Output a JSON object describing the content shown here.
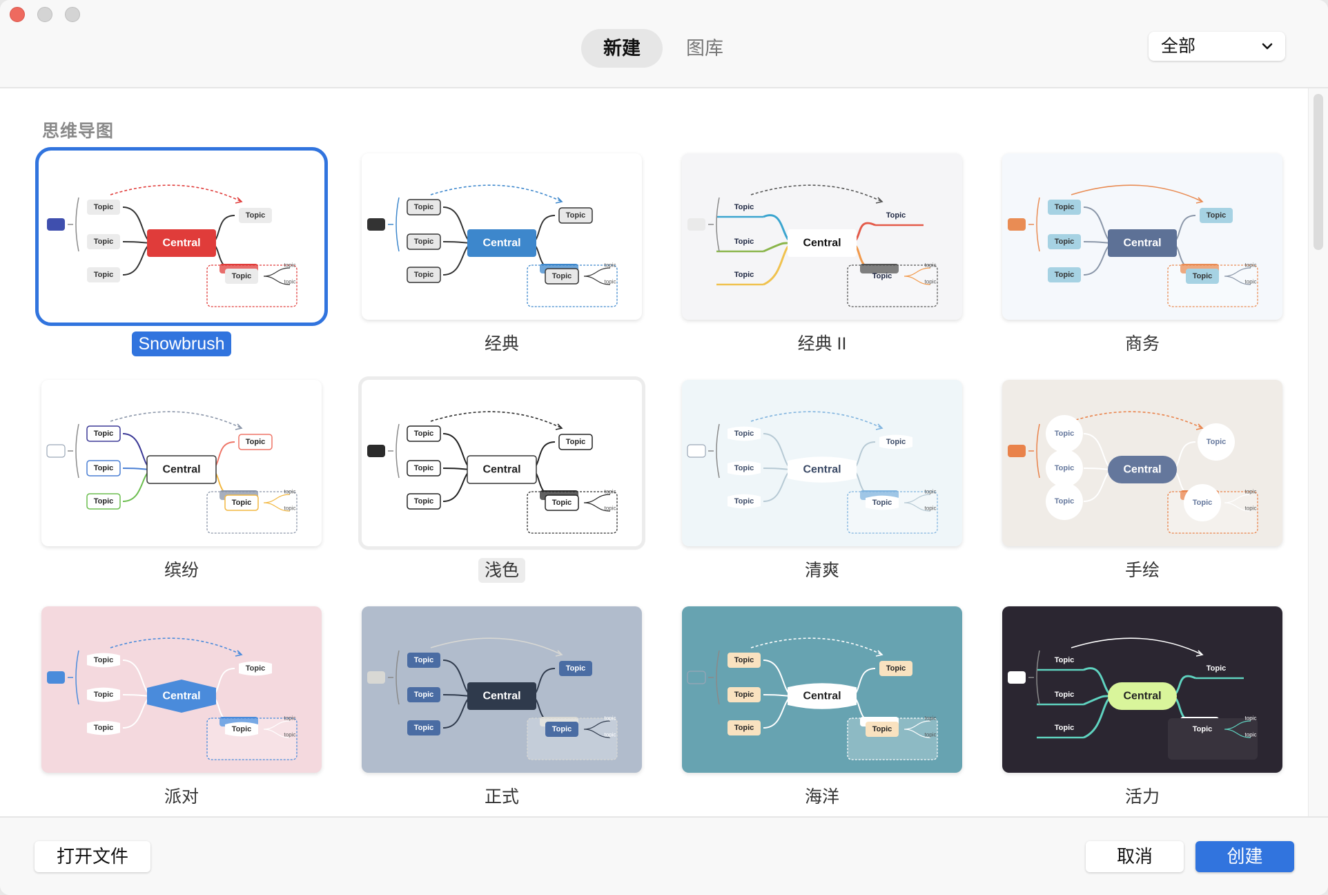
{
  "window": {
    "controls": [
      "close",
      "minimize",
      "maximize"
    ]
  },
  "header": {
    "tabs": [
      {
        "label": "新建",
        "active": true
      },
      {
        "label": "图库",
        "active": false
      }
    ],
    "filter": {
      "selected": "全部",
      "icon": "chevron-down-icon"
    }
  },
  "section": {
    "title": "思维导图"
  },
  "templates": [
    {
      "name": "Snowbrush",
      "state": "selected",
      "bg": "#ffffff",
      "central_fill": "#e03c3a",
      "central_text": "#ffffff",
      "topic_fill": "#ebebeb",
      "topic_stroke": "none",
      "topic_text": "#333333",
      "line": "#333333",
      "accent": "#e03c3a",
      "summary_fill": "#3f4fae",
      "central_shape": "rect"
    },
    {
      "name": "经典",
      "state": "normal",
      "bg": "#ffffff",
      "central_fill": "#3d87cc",
      "central_text": "#ffffff",
      "topic_fill": "#e8e8e8",
      "topic_stroke": "#333333",
      "topic_text": "#333333",
      "line": "#333333",
      "accent": "#3d87cc",
      "summary_fill": "#333333",
      "central_shape": "rect"
    },
    {
      "name": "经典 II",
      "state": "normal",
      "bg": "#f5f5f7",
      "central_fill": "#ffffff",
      "central_text": "#111111",
      "topic_fill": "none",
      "topic_stroke": "none",
      "topic_text": "#1c2540",
      "line": "#e45a49",
      "accent": "#555555",
      "summary_fill": "#eaeaea",
      "central_shape": "rect"
    },
    {
      "name": "商务",
      "state": "normal",
      "bg": "#f5f8fc",
      "central_fill": "#5d7196",
      "central_text": "#ffffff",
      "topic_fill": "#a6d2e3",
      "topic_stroke": "none",
      "topic_text": "#333333",
      "line": "#8a96a8",
      "accent": "#e98c54",
      "summary_fill": "#e98c54",
      "central_shape": "rect"
    },
    {
      "name": "缤纷",
      "state": "normal",
      "bg": "#ffffff",
      "central_fill": "#ffffff",
      "central_text": "#222222",
      "topic_fill": "#ffffff",
      "topic_stroke": "#3b3996",
      "topic_text": "#222222",
      "line": "#3b3996",
      "accent": "#8a95a8",
      "summary_fill": "#ffffff",
      "central_shape": "rect"
    },
    {
      "name": "浅色",
      "state": "hovered",
      "bg": "#ffffff",
      "central_fill": "#ffffff",
      "central_text": "#222222",
      "topic_fill": "#ffffff",
      "topic_stroke": "#222222",
      "topic_text": "#222222",
      "line": "#222222",
      "accent": "#2b2b2b",
      "summary_fill": "#2b2b2b",
      "central_shape": "rect"
    },
    {
      "name": "清爽",
      "state": "normal",
      "bg": "#eff6f9",
      "central_fill": "#ffffff",
      "central_text": "#3b4a66",
      "topic_fill": "#ffffff",
      "topic_stroke": "none",
      "topic_text": "#3b4a66",
      "line": "#b6c9d4",
      "accent": "#7fb3de",
      "summary_fill": "#ffffff",
      "central_shape": "barrel"
    },
    {
      "name": "手绘",
      "state": "normal",
      "bg": "#f0ece7",
      "central_fill": "#64779c",
      "central_text": "#ffffff",
      "topic_fill": "#ffffff",
      "topic_stroke": "none",
      "topic_text": "#64779c",
      "line": "#ffffff",
      "accent": "#e9824a",
      "summary_fill": "#e9824a",
      "central_shape": "pill"
    },
    {
      "name": "派对",
      "state": "normal",
      "bg": "#f4d9de",
      "central_fill": "#4a8bdb",
      "central_text": "#ffffff",
      "topic_fill": "#ffffff",
      "topic_stroke": "none",
      "topic_text": "#333333",
      "line": "#ffffff",
      "accent": "#4a8bdb",
      "summary_fill": "#4a8bdb",
      "central_shape": "hex"
    },
    {
      "name": "正式",
      "state": "normal",
      "bg": "#b1bccc",
      "central_fill": "#2f3a4c",
      "central_text": "#ffffff",
      "topic_fill": "#4a6ca3",
      "topic_stroke": "none",
      "topic_text": "#ffffff",
      "line": "#2f3a4c",
      "accent": "#d8d8d4",
      "summary_fill": "#d8d8d4",
      "central_shape": "rect"
    },
    {
      "name": "海洋",
      "state": "normal",
      "bg": "#67a3b1",
      "central_fill": "#ffffff",
      "central_text": "#222222",
      "topic_fill": "#f9e2c0",
      "topic_stroke": "none",
      "topic_text": "#222222",
      "line": "#ffffff",
      "accent": "#ffffff",
      "summary_fill": "none",
      "central_shape": "barrel"
    },
    {
      "name": "活力",
      "state": "normal",
      "bg": "#2b2631",
      "central_fill": "#d9f59b",
      "central_text": "#222222",
      "topic_fill": "none",
      "topic_stroke": "none",
      "topic_text": "#ffffff",
      "line": "#5fd3c0",
      "accent": "#ffffff",
      "summary_fill": "#ffffff",
      "central_shape": "pill"
    }
  ],
  "map_text": {
    "central": "Central",
    "topic": "Topic",
    "subtopic": "topic"
  },
  "footer": {
    "open_file": "打开文件",
    "cancel": "取消",
    "create": "创建"
  }
}
